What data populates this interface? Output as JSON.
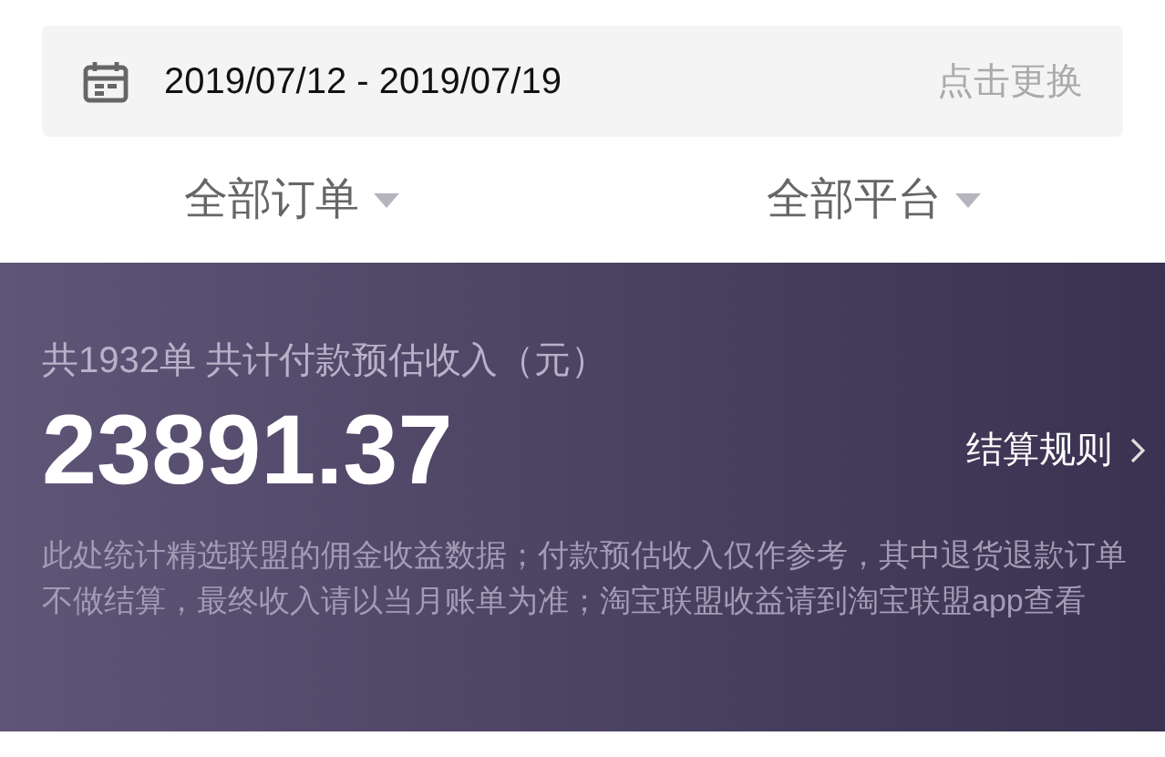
{
  "date_range": {
    "value": "2019/07/12 - 2019/07/19",
    "action": "点击更换"
  },
  "filters": [
    {
      "label": "全部订单"
    },
    {
      "label": "全部平台"
    }
  ],
  "summary": {
    "caption": "共1932单 共计付款预估收入（元）",
    "amount": "23891.37",
    "rules_link": "结算规则",
    "note": "此处统计精选联盟的佣金收益数据；付款预估收入仅作参考，其中退货退款订单不做结算，最终收入请以当月账单为准；淘宝联盟收益请到淘宝联盟app查看"
  }
}
